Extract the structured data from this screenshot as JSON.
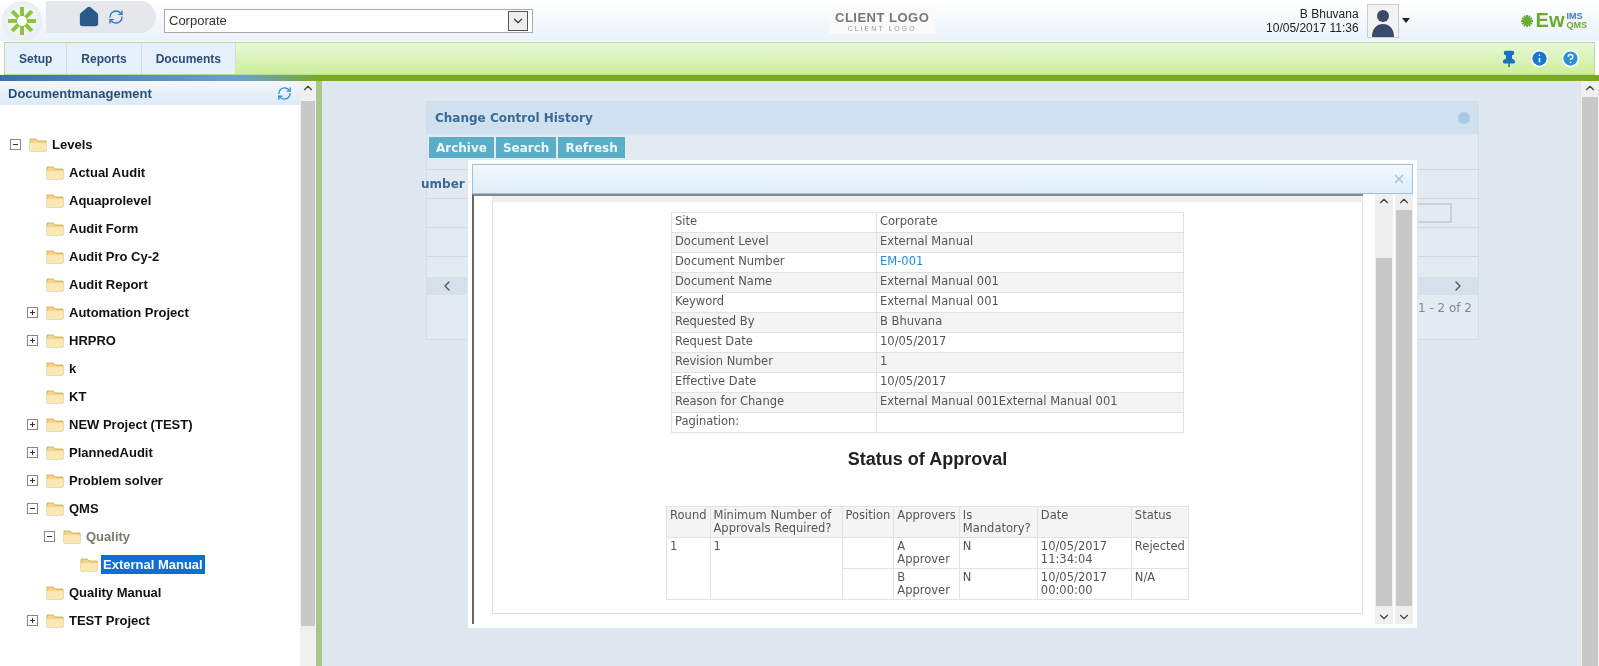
{
  "header": {
    "site_select": {
      "value": "Corporate"
    },
    "client_logo": {
      "title": "CLIENT LOGO",
      "tagline": "CLIENT LOGO"
    },
    "user": {
      "name": "B Bhuvana",
      "datetime": "10/05/2017 11:36"
    },
    "brand": {
      "main": "Ew",
      "top": "IMS",
      "bottom": "QMS"
    }
  },
  "menu": [
    {
      "label": "Setup",
      "selected": false
    },
    {
      "label": "Reports",
      "selected": false
    },
    {
      "label": "Documents",
      "selected": false
    }
  ],
  "sidebar": {
    "title": "Documentmanagement",
    "tree": [
      {
        "label": "Levels",
        "expanded": true,
        "selected": false,
        "muted": false,
        "children": [
          {
            "label": "Actual Audit",
            "selected": false,
            "muted": false
          },
          {
            "label": "Aquaprolevel",
            "selected": false,
            "muted": false
          },
          {
            "label": "Audit Form",
            "selected": false,
            "muted": false
          },
          {
            "label": "Audit Pro Cy-2",
            "selected": false,
            "muted": false
          },
          {
            "label": "Audit Report",
            "selected": false,
            "muted": false
          },
          {
            "label": "Automation Project",
            "expanded": false,
            "selected": false,
            "muted": false
          },
          {
            "label": "HRPRO",
            "expanded": false,
            "selected": false,
            "muted": false
          },
          {
            "label": "k",
            "selected": false,
            "muted": false
          },
          {
            "label": "KT",
            "selected": false,
            "muted": false
          },
          {
            "label": "NEW Project (TEST)",
            "expanded": false,
            "selected": false,
            "muted": false
          },
          {
            "label": "PlannedAudit",
            "expanded": false,
            "selected": false,
            "muted": false
          },
          {
            "label": "Problem solver",
            "expanded": false,
            "selected": false,
            "muted": false
          },
          {
            "label": "QMS",
            "expanded": true,
            "selected": false,
            "muted": false,
            "children": [
              {
                "label": "Quality",
                "expanded": true,
                "selected": false,
                "muted": true,
                "children": [
                  {
                    "label": "External Manual",
                    "selected": true,
                    "muted": false
                  }
                ]
              }
            ]
          },
          {
            "label": "Quality Manual",
            "selected": false,
            "muted": false
          },
          {
            "label": "TEST Project",
            "expanded": false,
            "selected": false,
            "muted": false
          }
        ]
      }
    ]
  },
  "panel": {
    "title": "Change Control History",
    "buttons": [
      "Archive",
      "Search",
      "Refresh"
    ],
    "column_1": "umber",
    "pager_text": "1 - 2 of 2"
  },
  "dialog": {
    "details": [
      {
        "label": "Site",
        "value": "Corporate",
        "kind": "text"
      },
      {
        "label": "Document Level",
        "value": "External Manual",
        "kind": "text"
      },
      {
        "label": "Document Number",
        "value": "EM-001",
        "kind": "link"
      },
      {
        "label": "Document Name",
        "value": "External Manual 001",
        "kind": "text"
      },
      {
        "label": "Keyword",
        "value": "External Manual 001",
        "kind": "text"
      },
      {
        "label": "Requested By",
        "value": "B Bhuvana",
        "kind": "text"
      },
      {
        "label": "Request Date",
        "value": "10/05/2017",
        "kind": "text"
      },
      {
        "label": "Revision Number",
        "value": "1",
        "kind": "text"
      },
      {
        "label": "Effective Date",
        "value": "10/05/2017",
        "kind": "text"
      },
      {
        "label": "Reason for Change",
        "value": "External Manual 001External Manual 001",
        "kind": "text"
      },
      {
        "label": "Pagination:",
        "kind": "text"
      }
    ],
    "approval_title": "Status of Approval",
    "approval_columns": [
      "Round",
      "Minimum Number of Approvals Required?",
      "Position",
      "Approvers",
      "Is Mandatory?",
      "Date",
      "Status"
    ],
    "approval_rounds": [
      {
        "round": "1",
        "minimum": "1",
        "approvers": [
          {
            "approver": "A Approver",
            "mandatory": "N",
            "date": "10/05/2017 11:34:04",
            "status": "Rejected"
          },
          {
            "approver": "B Approver",
            "mandatory": "N",
            "date": "10/05/2017 00:00:00",
            "status": "N/A"
          }
        ]
      }
    ]
  }
}
